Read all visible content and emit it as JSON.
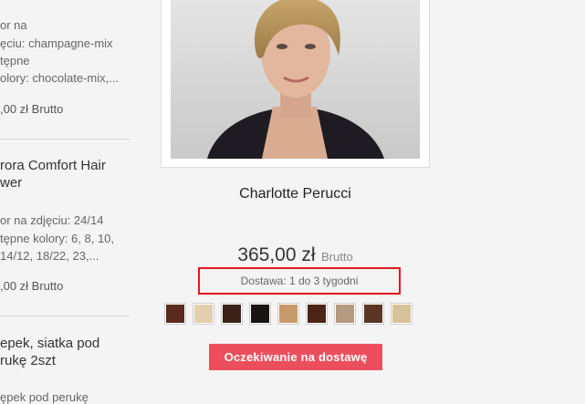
{
  "sidebar": {
    "item1": {
      "lines": [
        "or na",
        "ęciu: champagne-mix",
        "tępne",
        "olory: chocolate-mix,..."
      ],
      "price": ",00 zł Brutto"
    },
    "item2": {
      "title_lines": [
        "rora Comfort Hair",
        "wer"
      ],
      "lines": [
        "or na zdjęciu: 24/14",
        "tępne kolory: 6, 8, 10,",
        "14/12, 18/22, 23,..."
      ],
      "price": ",00 zł Brutto"
    },
    "item3": {
      "title_lines": [
        "epek, siatka pod",
        "rukę 2szt"
      ],
      "lines": [
        "ępek pod perukę"
      ]
    }
  },
  "product": {
    "name": "Charlotte Perucci",
    "price": "365,00 zł",
    "price_suffix": "Brutto",
    "delivery": "Dostawa: 1 do 3 tygodni",
    "button_label": "Oczekiwanie na dostawę",
    "button_color": "#ec4f5c",
    "highlight_color": "#e5171c",
    "swatches": [
      {
        "name": "dark-auburn",
        "color": "#5a2a1c"
      },
      {
        "name": "light-blonde",
        "color": "#e3cfae"
      },
      {
        "name": "dark-brown",
        "color": "#3b2219"
      },
      {
        "name": "black",
        "color": "#1a1412"
      },
      {
        "name": "caramel-blonde",
        "color": "#c79a6c"
      },
      {
        "name": "mahogany",
        "color": "#4d2418"
      },
      {
        "name": "ash-mix",
        "color": "#b49a80"
      },
      {
        "name": "chestnut",
        "color": "#5b3625"
      },
      {
        "name": "champagne",
        "color": "#d7c39a"
      }
    ]
  }
}
